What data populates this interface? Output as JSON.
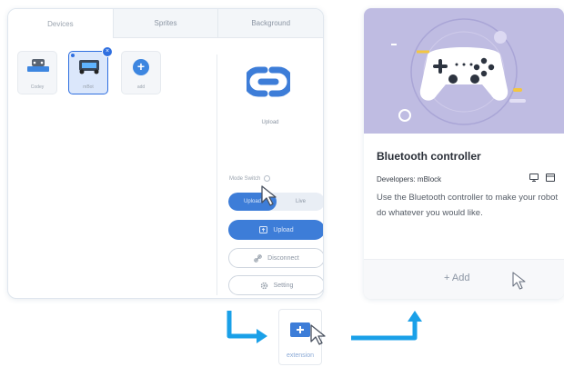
{
  "tabs": [
    {
      "label": "Devices",
      "active": true
    },
    {
      "label": "Sprites",
      "active": false
    },
    {
      "label": "Background",
      "active": false
    }
  ],
  "devices": [
    {
      "label": "Codey",
      "selected": false
    },
    {
      "label": "mBot",
      "selected": true
    },
    {
      "label": "add",
      "selected": false
    }
  ],
  "device_panel": {
    "upload_caption": "Upload",
    "mode_switch_label": "Mode Switch",
    "mode_options": [
      "Upload",
      "Live"
    ],
    "upload_button": "Upload",
    "disconnect_button": "Disconnect",
    "setting_button": "Setting"
  },
  "extension_card": {
    "title": "Bluetooth controller",
    "developers": "Developers: mBlock",
    "description": "Use the Bluetooth controller to make your robot do whatever you would like.",
    "add_button": "+ Add"
  },
  "extension_button": {
    "label": "extension"
  },
  "colors": {
    "accent": "#3d7dd8",
    "flow_arrow": "#1aa0e8",
    "card_hero": "#bfbce2"
  }
}
